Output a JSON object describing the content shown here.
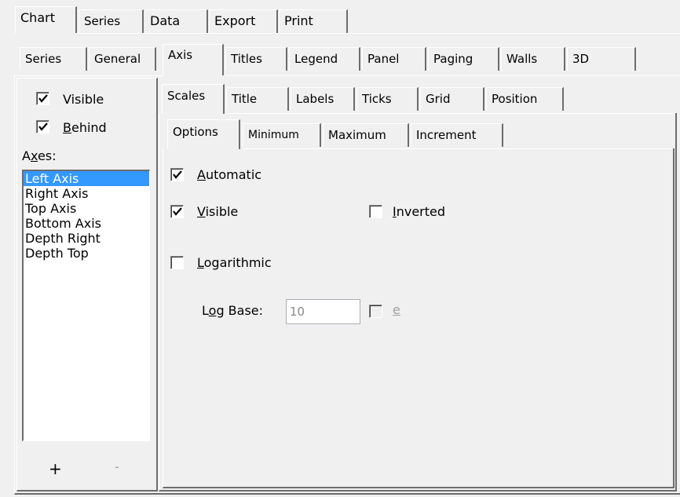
{
  "top_tabs": [
    "Chart",
    "Series",
    "Data",
    "Export",
    "Print"
  ],
  "chart_tabs": [
    "Series",
    "General",
    "Axis",
    "Titles",
    "Legend",
    "Panel",
    "Paging",
    "Walls",
    "3D"
  ],
  "axis_tabs": [
    "Scales",
    "Title",
    "Labels",
    "Ticks",
    "Grid",
    "Position"
  ],
  "scales_tabs": [
    "Options",
    "Minimum",
    "Maximum",
    "Increment"
  ],
  "left": {
    "visible_label": "Visible",
    "visible_checked": true,
    "behind_label_pre": "",
    "behind_label_u": "B",
    "behind_label_post": "ehind",
    "behind_checked": true,
    "axes_label_pre": "A",
    "axes_label_u": "x",
    "axes_label_post": "es:",
    "axes": [
      "Left Axis",
      "Right Axis",
      "Top Axis",
      "Bottom Axis",
      "Depth Right",
      "Depth Top"
    ],
    "selected_axis": "Left Axis",
    "add_label": "+",
    "remove_label": "-"
  },
  "options": {
    "automatic_u": "A",
    "automatic_rest": "utomatic",
    "automatic_checked": true,
    "visible_u": "V",
    "visible_rest": "isible",
    "visible_checked": true,
    "inverted_u": "I",
    "inverted_rest": "nverted",
    "inverted_checked": false,
    "logarithmic_u": "L",
    "logarithmic_rest": "ogarithmic",
    "logarithmic_checked": false,
    "logbase_pre": "L",
    "logbase_u": "o",
    "logbase_post": "g Base:",
    "logbase_value": "10",
    "e_label": "e",
    "e_checked": false
  }
}
